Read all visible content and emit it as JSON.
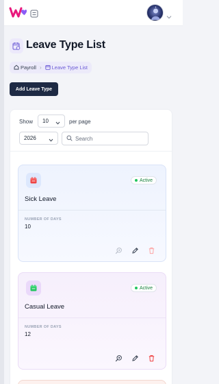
{
  "header": {
    "logo_icon": "workspace-logo-icon",
    "menu_icon": "list-menu-icon",
    "avatar_icon": "user-avatar",
    "avatar_chevron_icon": "chevron-down-icon"
  },
  "page": {
    "title": "Leave Type List",
    "title_icon": "calendar-clock-icon"
  },
  "breadcrumb": [
    {
      "label": "Payroll",
      "icon": "home-icon"
    },
    {
      "label": "Leave Type List",
      "icon": "calendar-icon"
    }
  ],
  "toolbar": {
    "add_label": "Add Leave Type"
  },
  "filters": {
    "show_label": "Show",
    "per_page_value": "10",
    "per_page_label": "per page",
    "year_value": "2026",
    "search_placeholder": "Search"
  },
  "cards": [
    {
      "name": "Sick Leave",
      "status": "Active",
      "days_label": "NUMBER OF DAYS",
      "days": "10",
      "accent": "#ef4444",
      "icon": "calendar-icon"
    },
    {
      "name": "Casual Leave",
      "status": "Active",
      "days_label": "NUMBER OF DAYS",
      "days": "12",
      "accent": "#22c55e",
      "icon": "calendar-icon"
    }
  ],
  "colors": {
    "primary_button": "#1e2a44",
    "accent_purple": "#6b5bd6",
    "status_green": "#22c55e",
    "delete_red": "#ef4444"
  }
}
